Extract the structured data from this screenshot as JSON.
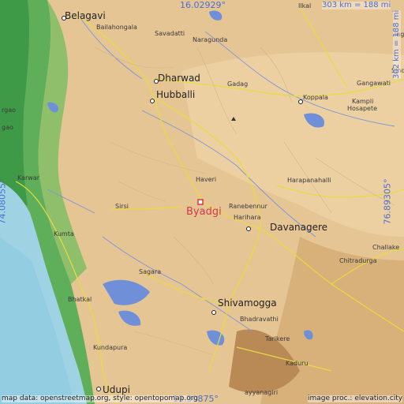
{
  "map": {
    "selected_place": "Byadgi",
    "lat_top": "16.02929°",
    "lat_bottom": "13.30875°",
    "lon_left": "74.08055°",
    "lon_right": "76.89305°",
    "scale_top": "303 km = 188 mi",
    "scale_right": "302 km = 188 mi",
    "credit_left": "map data: openstreetmap.org, style: opentopomap.org",
    "credit_right": "image proc.: elevation.city",
    "places": {
      "belagavi": "Belagavi",
      "bailahongala": "Bailahongala",
      "savadatti": "Savadatti",
      "naragunda": "Naragunda",
      "ilkal": "Ilkal",
      "dharwad": "Dharwad",
      "hubballi": "Hubballi",
      "gadag": "Gadag",
      "koppala": "Koppala",
      "gangawati": "Gangawati",
      "kampli": "Kampli",
      "hosapete": "Hosapete",
      "karwar": "Karwar",
      "haveri": "Haveri",
      "harapanahalli": "Harapanahalli",
      "sirsi": "Sirsi",
      "ranebennur": "Ranebennur",
      "harihara": "Harihara",
      "davanagere": "Davanagere",
      "kumta": "Kumta",
      "challake": "Challake",
      "chitradurga": "Chitradurga",
      "sagara": "Sagara",
      "bhatkal": "Bhatkal",
      "shivamogga": "Shivamogga",
      "bhadravathi": "Bhadravathi",
      "tarikere": "Tarikere",
      "kundapura": "Kundapura",
      "kaduru": "Kaduru",
      "udupi": "Udupi",
      "chikkamagaluru_fragment": "ayyanagiri",
      "goa_fragment": "gao",
      "goa_fragment2": "rgao",
      "sindh_fragment": "Sindh",
      "lingsugur_fragment": "ing"
    }
  }
}
